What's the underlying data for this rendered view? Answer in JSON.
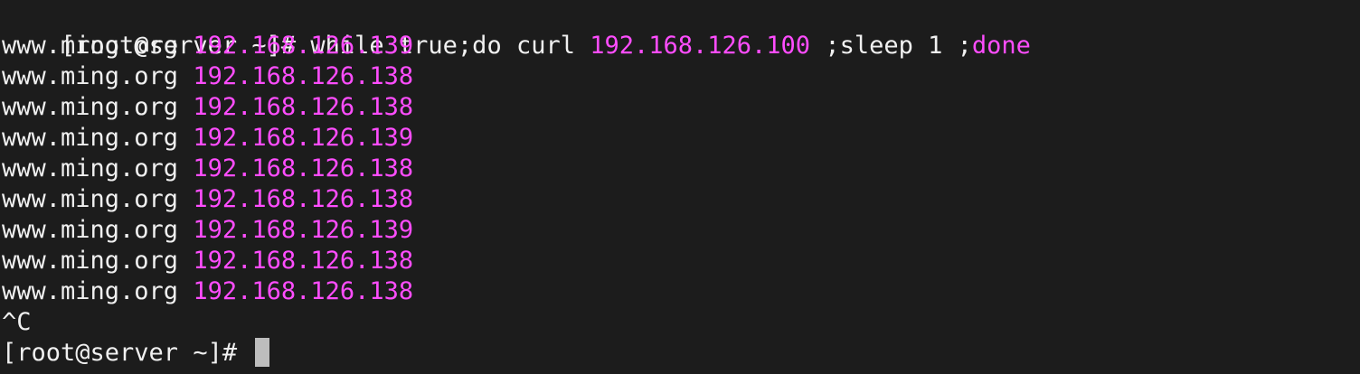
{
  "terminal": {
    "prompt": "[root@server ~]# ",
    "command": {
      "part1": "while true;do curl ",
      "ip": "192.168.126.100",
      "part2": " ;sleep 1 ;",
      "done": "done"
    },
    "output": [
      {
        "host": "www.ming.org ",
        "ip": "192.168.126.139"
      },
      {
        "host": "www.ming.org ",
        "ip": "192.168.126.138"
      },
      {
        "host": "www.ming.org ",
        "ip": "192.168.126.138"
      },
      {
        "host": "www.ming.org ",
        "ip": "192.168.126.139"
      },
      {
        "host": "www.ming.org ",
        "ip": "192.168.126.138"
      },
      {
        "host": "www.ming.org ",
        "ip": "192.168.126.138"
      },
      {
        "host": "www.ming.org ",
        "ip": "192.168.126.139"
      },
      {
        "host": "www.ming.org ",
        "ip": "192.168.126.138"
      },
      {
        "host": "www.ming.org ",
        "ip": "192.168.126.138"
      }
    ],
    "interrupt": "^C",
    "final_prompt": "[root@server ~]# "
  },
  "colors": {
    "background": "#1c1c1c",
    "text": "#f0f0f0",
    "highlight": "#ff4dff",
    "cursor": "#bdbdbd"
  }
}
